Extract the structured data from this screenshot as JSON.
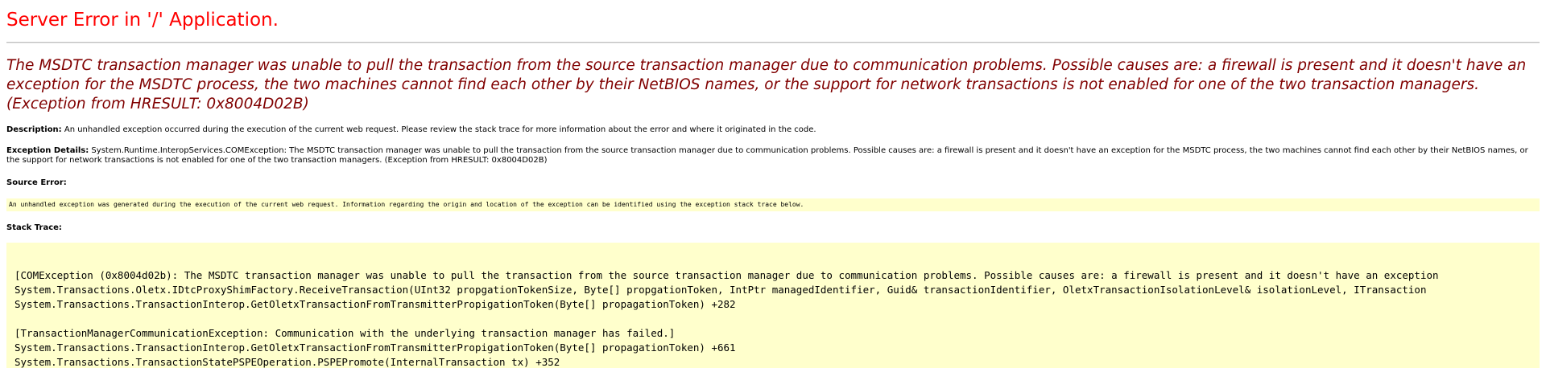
{
  "title": "Server Error in '/' Application.",
  "error_message": "The MSDTC transaction manager was unable to pull the transaction from the source transaction manager due to communication problems. Possible causes are: a firewall is present and it doesn't have an exception for the MSDTC process, the two machines cannot find each other by their NetBIOS names, or the support for network transactions is not enabled for one of the two transaction managers. (Exception from HRESULT: 0x8004D02B)",
  "description": {
    "label": "Description:",
    "text": " An unhandled exception occurred during the execution of the current web request. Please review the stack trace for more information about the error and where it originated in the code."
  },
  "exception_details": {
    "label": "Exception Details:",
    "text": " System.Runtime.InteropServices.COMException: The MSDTC transaction manager was unable to pull the transaction from the source transaction manager due to communication problems. Possible causes are: a firewall is present and it doesn't have an exception for the MSDTC process, the two machines cannot find each other by their NetBIOS names, or the support for network transactions is not enabled for one of the two transaction managers. (Exception from HRESULT: 0x8004D02B)"
  },
  "source_error": {
    "label": "Source Error:",
    "text": "An unhandled exception was generated during the execution of the current web request. Information regarding the origin and location of the exception can be identified using the exception stack trace below."
  },
  "stack_trace": {
    "label": "Stack Trace:",
    "lines": [
      "[COMException (0x8004d02b): The MSDTC transaction manager was unable to pull the transaction from the source transaction manager due to communication problems. Possible causes are: a firewall is present and it doesn't have an exception",
      "   System.Transactions.Oletx.IDtcProxyShimFactory.ReceiveTransaction(UInt32 propgationTokenSize, Byte[] propgationToken, IntPtr managedIdentifier, Guid& transactionIdentifier, OletxTransactionIsolationLevel& isolationLevel, ITransaction",
      "   System.Transactions.TransactionInterop.GetOletxTransactionFromTransmitterPropigationToken(Byte[] propagationToken) +282",
      "",
      "[TransactionManagerCommunicationException: Communication with the underlying transaction manager has failed.]",
      "   System.Transactions.TransactionInterop.GetOletxTransactionFromTransmitterPropigationToken(Byte[] propagationToken) +661",
      "   System.Transactions.TransactionStatePSPEOperation.PSPEPromote(InternalTransaction tx) +352"
    ]
  },
  "colors": {
    "title": "#ff0000",
    "error_message": "#800000",
    "code_background": "#ffffcc"
  }
}
